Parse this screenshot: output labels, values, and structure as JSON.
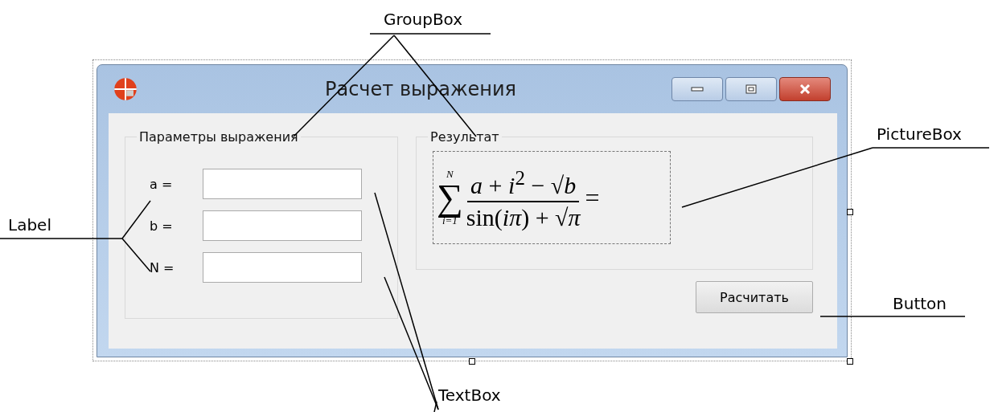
{
  "form": {
    "title": "Расчет выражения",
    "params_group": {
      "title": "Параметры выражения",
      "fields": [
        {
          "label": "a ="
        },
        {
          "label": "b ="
        },
        {
          "label": "N ="
        }
      ]
    },
    "result_group": {
      "title": "Результат",
      "formula": {
        "sigma": "∑",
        "upper": "N",
        "lower": "i=1",
        "numerator": "*a* + *i*$^{2}$ − √*b*",
        "denominator": "sin(*iπ*) + √*π*",
        "tail": "="
      }
    },
    "button": "Расчитать"
  },
  "callouts": [
    {
      "text": "GroupBox"
    },
    {
      "text": "Label"
    },
    {
      "text": "PictureBox"
    },
    {
      "text": "Button"
    },
    {
      "text": "TextBox"
    }
  ]
}
